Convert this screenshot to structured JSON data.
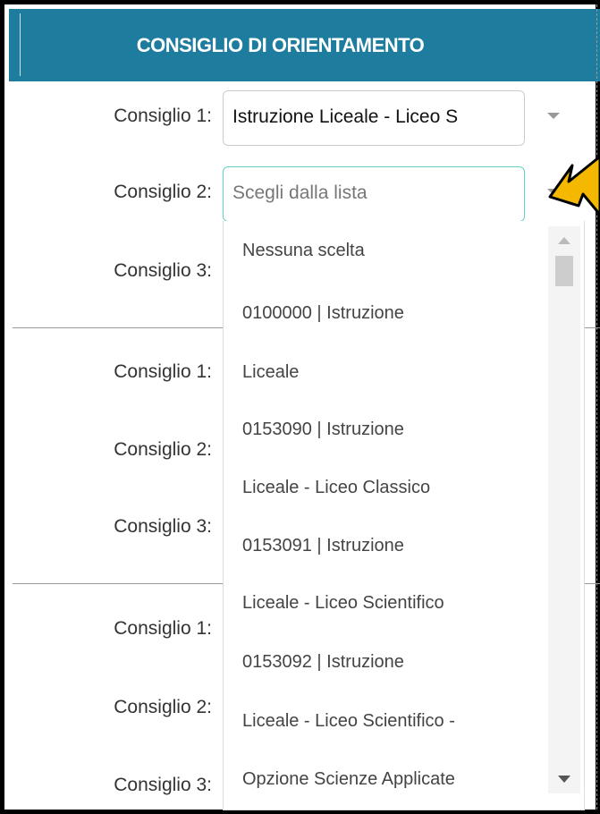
{
  "header": {
    "title": "CONSIGLIO DI ORIENTAMENTO"
  },
  "section1": {
    "label1": "Consiglio 1:",
    "value1": "Istruzione Liceale - Liceo S",
    "label2": "Consiglio 2:",
    "placeholder2": "Scegli dalla lista",
    "label3": "Consiglio 3:"
  },
  "section2": {
    "label1": "Consiglio 1:",
    "label2": "Consiglio 2:",
    "label3": "Consiglio 3:"
  },
  "section3": {
    "label1": "Consiglio 1:",
    "label2": "Consiglio 2:",
    "label3": "Consiglio 3:"
  },
  "dropdown": {
    "options": [
      "Nessuna scelta",
      "0100000 | Istruzione",
      "Liceale",
      "0153090 | Istruzione",
      "Liceale - Liceo Classico",
      "0153091 | Istruzione",
      "Liceale - Liceo Scientifico",
      "0153092 | Istruzione",
      "Liceale - Liceo Scientifico -",
      "Opzione Scienze Applicate"
    ]
  },
  "colors": {
    "header_bg": "#1e7c9f",
    "focus_border": "#66d1c5",
    "callout": "#f5b800"
  },
  "icons": {
    "callout": "arrow-callout-icon",
    "caret": "caret-down-icon"
  }
}
